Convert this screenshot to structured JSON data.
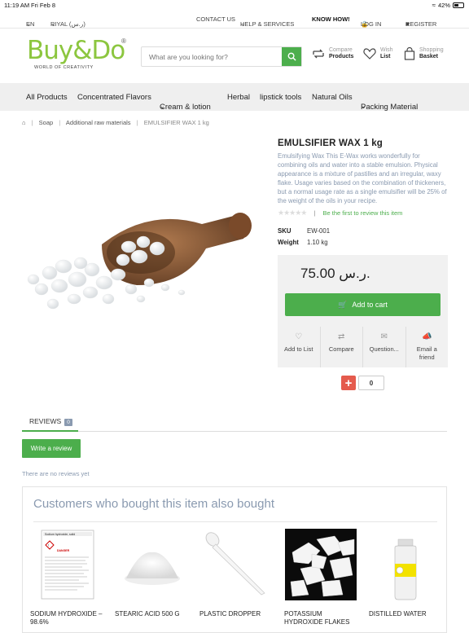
{
  "status_bar": {
    "time": "11:19 AM",
    "date": "Fri Feb 8",
    "battery": "42%"
  },
  "topbar": {
    "language": "EN",
    "currency": "RIYAL (ر.س)",
    "contact": "CONTACT US",
    "help": "HELP & SERVICES",
    "know_how": "KNOW HOW!",
    "login": "LOG IN",
    "register": "REGISTER"
  },
  "header": {
    "logo_text": "Buy&Do",
    "logo_tagline": "WORLD OF CREATIVITY",
    "search_placeholder": "What are you looking for?",
    "compare_top": "Compare",
    "compare_bottom": "Products",
    "wish_top": "Wish",
    "wish_bottom": "List",
    "basket_top": "Shopping",
    "basket_bottom": "Basket"
  },
  "nav": [
    "All Products",
    "Concentrated Flavors",
    "Cream & lotion",
    "Herbal",
    "lipstick tools",
    "Natural Oils",
    "Packing Material"
  ],
  "breadcrumb": {
    "items": [
      "Soap",
      "Additional raw materials"
    ],
    "current": "EMULSIFIER WAX 1 kg"
  },
  "product": {
    "title": "EMULSIFIER WAX 1 kg",
    "description": "Emulsifying Wax   This E-Wax works wonderfully for combining oils and water into a stable emulsion. Physical appearance is a mixture of pastilles and an irregular, waxy flake. Usage varies based on the combination of thickeners, but a normal usage rate as a single emulsifier will be 25% of the weight of the oils in your recipe.",
    "review_prompt": "Be the first to review this item",
    "rating": 0,
    "sku_label": "SKU",
    "sku": "EW-001",
    "weight_label": "Weight",
    "weight": "1.10 kg",
    "price": "75.00 ر.س.",
    "add_to_cart": "Add to cart",
    "quantity": "0",
    "actions": [
      "Add to List",
      "Compare",
      "Question...",
      "Email a friend"
    ]
  },
  "reviews": {
    "tab_label": "REVIEWS",
    "count": "0",
    "write_button": "Write a review",
    "empty_text": "There are no reviews yet"
  },
  "related": {
    "heading": "Customers who bought this item also bought",
    "items": [
      "SODIUM HYDROXIDE – 98.6%",
      "STEARIC ACID 500 G",
      "PLASTIC DROPPER",
      "POTASSIUM HYDROXIDE FLAKES",
      "DISTILLED WATER"
    ],
    "label_texts": {
      "danger_label": "DANGER",
      "sds_title": "Sodium hydroxide, solid"
    }
  },
  "colors": {
    "accent": "#4cae4c",
    "logo_green": "#8cc63f",
    "muted_text": "#8a9ab0",
    "qty_plus": "#e55b4d"
  }
}
